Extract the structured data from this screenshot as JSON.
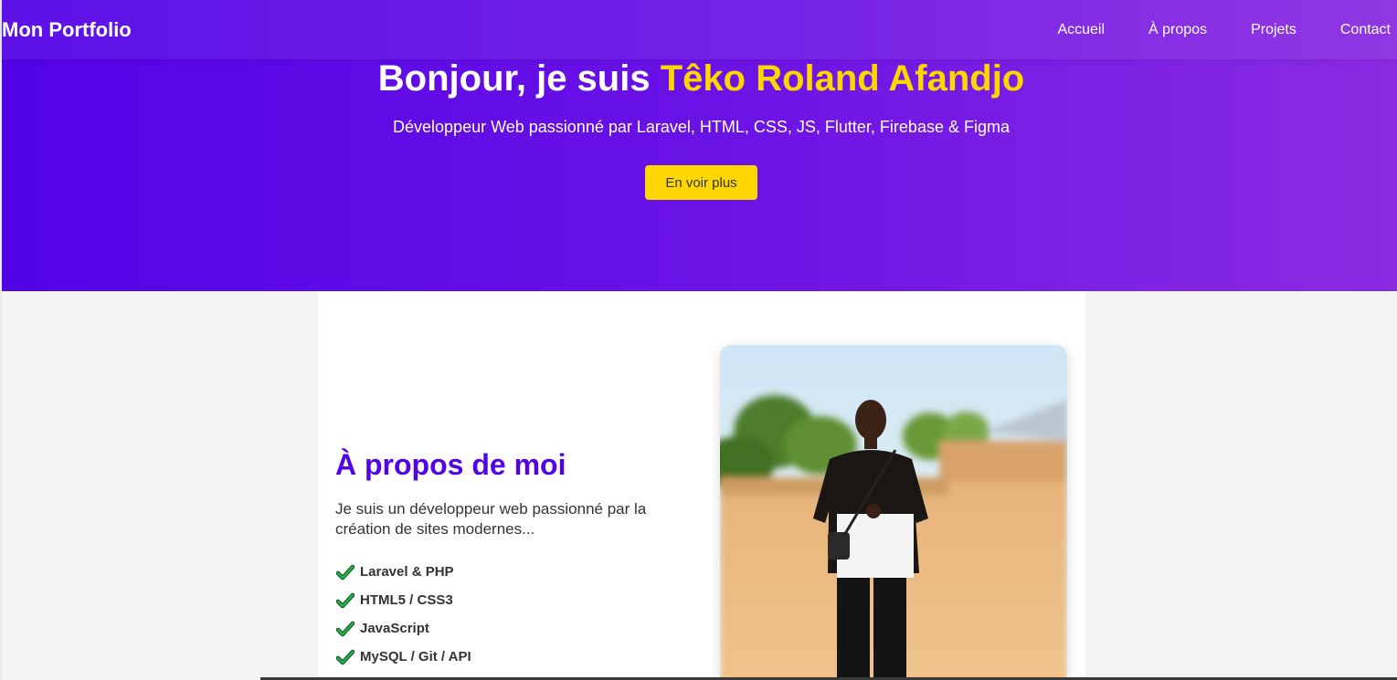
{
  "nav": {
    "brand": "Mon Portfolio",
    "links": [
      "Accueil",
      "À propos",
      "Projets",
      "Contact"
    ]
  },
  "hero": {
    "greeting": "Bonjour, je suis ",
    "name": "Têko Roland Afandjo",
    "subtitle": "Développeur Web passionné par Laravel, HTML, CSS, JS, Flutter, Firebase & Figma",
    "button_label": "En voir plus"
  },
  "about": {
    "title": "À propos de moi",
    "description": "Je suis un développeur web passionné par la création de sites modernes...",
    "skills": [
      "Laravel & PHP",
      "HTML5 / CSS3",
      "JavaScript",
      "MySQL / Git / API"
    ],
    "photo_icon": "profile-photo"
  },
  "colors": {
    "primary": "#5203e6",
    "accent": "#ffd700",
    "check": "#1f9d3a"
  }
}
